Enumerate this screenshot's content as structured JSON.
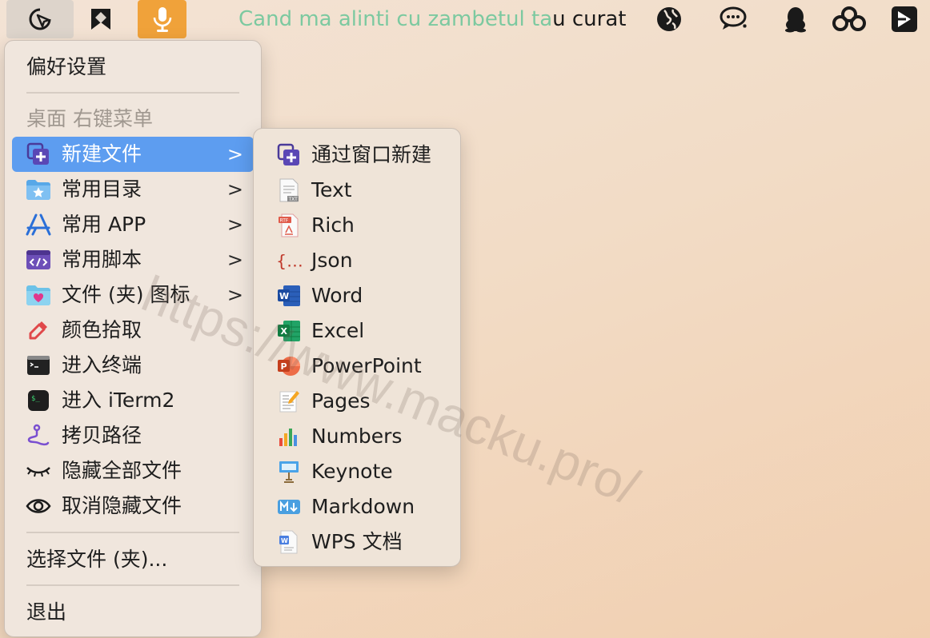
{
  "menubar": {
    "lyrics_sung": "Cand ma alinti cu zambetul ta",
    "lyrics_rest": "u curat",
    "accent_mic": "#f0a23a",
    "icons": [
      "cursor-icon",
      "pin-icon",
      "microphone-icon",
      "globe-icon",
      "chat-bubble-icon",
      "penguin-icon",
      "cloud-icon",
      "media-play-icon"
    ]
  },
  "menu": {
    "preferences": "偏好设置",
    "section_title": "桌面 右键菜单",
    "items": [
      {
        "label": "新建文件",
        "icon": "new-file-icon",
        "submenu": true,
        "selected": true
      },
      {
        "label": "常用目录",
        "icon": "folder-star-icon",
        "submenu": true
      },
      {
        "label": "常用 APP",
        "icon": "app-store-icon",
        "submenu": true
      },
      {
        "label": "常用脚本",
        "icon": "script-icon",
        "submenu": true
      },
      {
        "label": "文件 (夹) 图标",
        "icon": "folder-heart-icon",
        "submenu": true
      },
      {
        "label": "颜色拾取",
        "icon": "eyedropper-icon"
      },
      {
        "label": "进入终端",
        "icon": "terminal-icon"
      },
      {
        "label": "进入 iTerm2",
        "icon": "iterm-icon"
      },
      {
        "label": "拷贝路径",
        "icon": "path-icon"
      },
      {
        "label": "隐藏全部文件",
        "icon": "eye-closed-icon"
      },
      {
        "label": "取消隐藏文件",
        "icon": "eye-open-icon"
      }
    ],
    "choose_file": "选择文件 (夹)...",
    "quit": "退出",
    "chevron": ">",
    "highlight_color": "#5d9df0"
  },
  "submenu": {
    "items": [
      {
        "label": "通过窗口新建",
        "icon": "new-window-icon"
      },
      {
        "label": "Text",
        "icon": "txt-file-icon"
      },
      {
        "label": "Rich",
        "icon": "rtf-file-icon"
      },
      {
        "label": "Json",
        "icon": "json-file-icon"
      },
      {
        "label": "Word",
        "icon": "word-icon"
      },
      {
        "label": "Excel",
        "icon": "excel-icon"
      },
      {
        "label": "PowerPoint",
        "icon": "powerpoint-icon"
      },
      {
        "label": "Pages",
        "icon": "pages-icon"
      },
      {
        "label": "Numbers",
        "icon": "numbers-icon"
      },
      {
        "label": "Keynote",
        "icon": "keynote-icon"
      },
      {
        "label": "Markdown",
        "icon": "markdown-icon"
      },
      {
        "label": "WPS 文档",
        "icon": "wps-doc-icon"
      }
    ]
  },
  "watermark": "https://www.macku.pro/"
}
